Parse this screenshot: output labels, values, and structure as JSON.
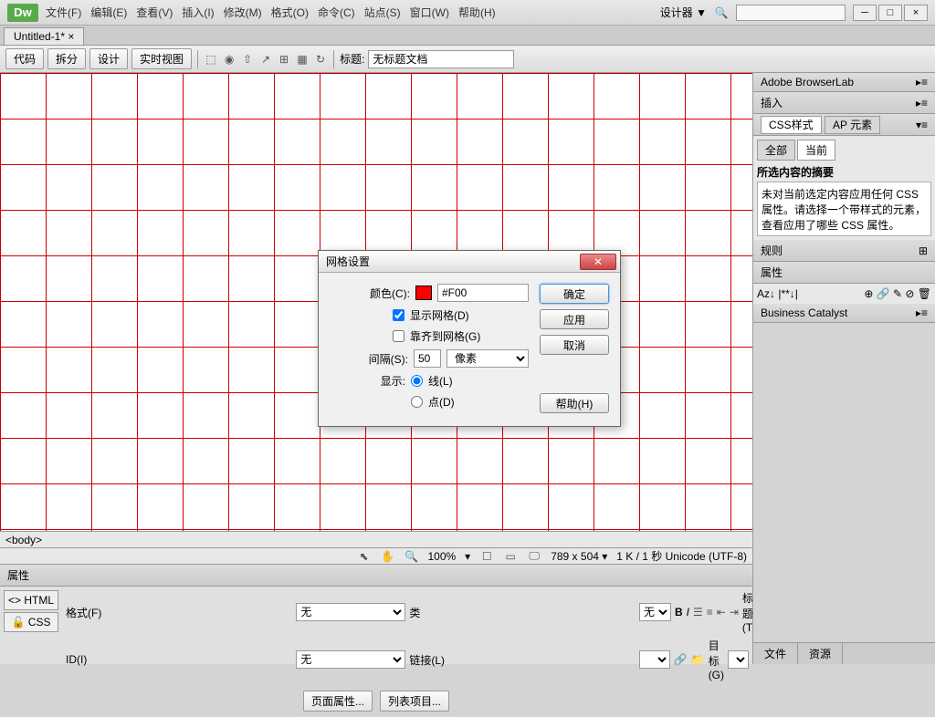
{
  "app": {
    "logo": "Dw",
    "designer_label": "设计器 ▼"
  },
  "menu": [
    "文件(F)",
    "编辑(E)",
    "查看(V)",
    "插入(I)",
    "修改(M)",
    "格式(O)",
    "命令(C)",
    "站点(S)",
    "窗口(W)",
    "帮助(H)"
  ],
  "doc_tab": "Untitled-1* ×",
  "toolbar": {
    "views": [
      "代码",
      "拆分",
      "设计",
      "实时视图"
    ],
    "title_label": "标题:",
    "title_value": "无标题文档"
  },
  "tag_selector": "<body>",
  "status": {
    "zoom": "100%",
    "size": "789 x 504 ▾",
    "info": "1 K / 1 秒  Unicode (UTF-8)"
  },
  "panels": {
    "browserlab": "Adobe BrowserLab",
    "insert": "插入",
    "css_tab": "CSS样式",
    "ap_tab": "AP 元素",
    "all": "全部",
    "current": "当前",
    "summary_title": "所选内容的摘要",
    "summary_text": "未对当前选定内容应用任何 CSS 属性。请选择一个带样式的元素，查看应用了哪些 CSS 属性。",
    "rules": "规则",
    "properties": "属性",
    "az": "Az↓ |**↓|",
    "biz": "Business Catalyst",
    "files_tab": "文件",
    "assets_tab": "资源"
  },
  "props": {
    "title": "属性",
    "html_btn": "<> HTML",
    "css_btn": "🔓 CSS",
    "format_label": "格式(F)",
    "format_value": "无",
    "class_label": "类",
    "class_value": "无",
    "id_label": "ID(I)",
    "id_value": "无",
    "link_label": "链接(L)",
    "title_attr_label": "标题(T)",
    "target_label": "目标(G)",
    "page_props_btn": "页面属性...",
    "list_items_btn": "列表项目..."
  },
  "dialog": {
    "title": "网格设置",
    "color_label": "颜色(C):",
    "color_value": "#F00",
    "show_grid": "显示网格(D)",
    "snap_grid": "靠齐到网格(G)",
    "spacing_label": "间隔(S):",
    "spacing_value": "50",
    "spacing_unit": "像素",
    "display_label": "显示:",
    "lines": "线(L)",
    "dots": "点(D)",
    "ok": "确定",
    "apply": "应用",
    "cancel": "取消",
    "help": "帮助(H)"
  }
}
